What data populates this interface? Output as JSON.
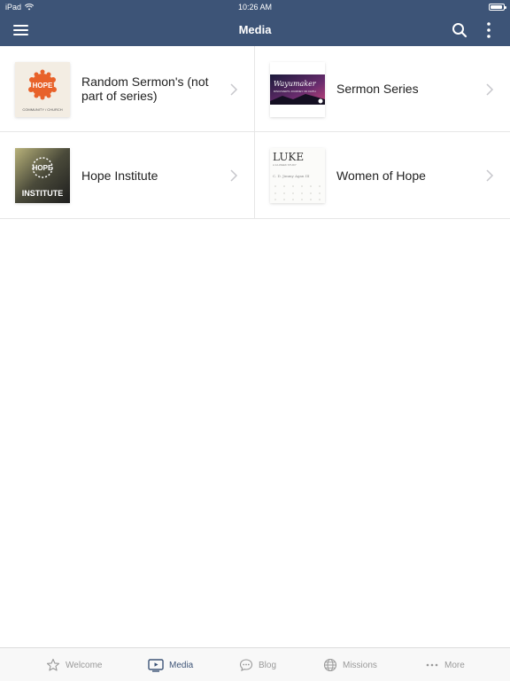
{
  "status_bar": {
    "device": "iPad",
    "time": "10:26 AM",
    "battery_level": 0.95
  },
  "nav_bar": {
    "title": "Media"
  },
  "media_items": [
    {
      "label": "Random Sermon's (not part of series)",
      "thumb_text": "HOPE",
      "thumb_subtext": "COMMUNITY / CHURCH"
    },
    {
      "label": "Sermon Series",
      "thumb_text": "Wayumaker",
      "thumb_subtext": "DISCOVER'S JOURNEY OF FAITH"
    },
    {
      "label": "Hope Institute",
      "thumb_text": "HOPE",
      "thumb_subtext": "INSTITUTE"
    },
    {
      "label": "Women of Hope",
      "thumb_text": "LUKE",
      "thumb_subtext": "A 12-WEEK STUDY",
      "thumb_author": "C. D. Jimmy Agan III"
    }
  ],
  "tab_bar": {
    "tabs": [
      {
        "label": "Welcome",
        "icon": "star-icon",
        "active": false
      },
      {
        "label": "Media",
        "icon": "media-icon",
        "active": true
      },
      {
        "label": "Blog",
        "icon": "chat-icon",
        "active": false
      },
      {
        "label": "Missions",
        "icon": "globe-icon",
        "active": false
      },
      {
        "label": "More",
        "icon": "ellipsis-icon",
        "active": false
      }
    ]
  },
  "colors": {
    "header": "#3d5477",
    "active_tab": "#3d5477",
    "inactive_tab": "#999999",
    "hope_orange": "#e8622a"
  }
}
